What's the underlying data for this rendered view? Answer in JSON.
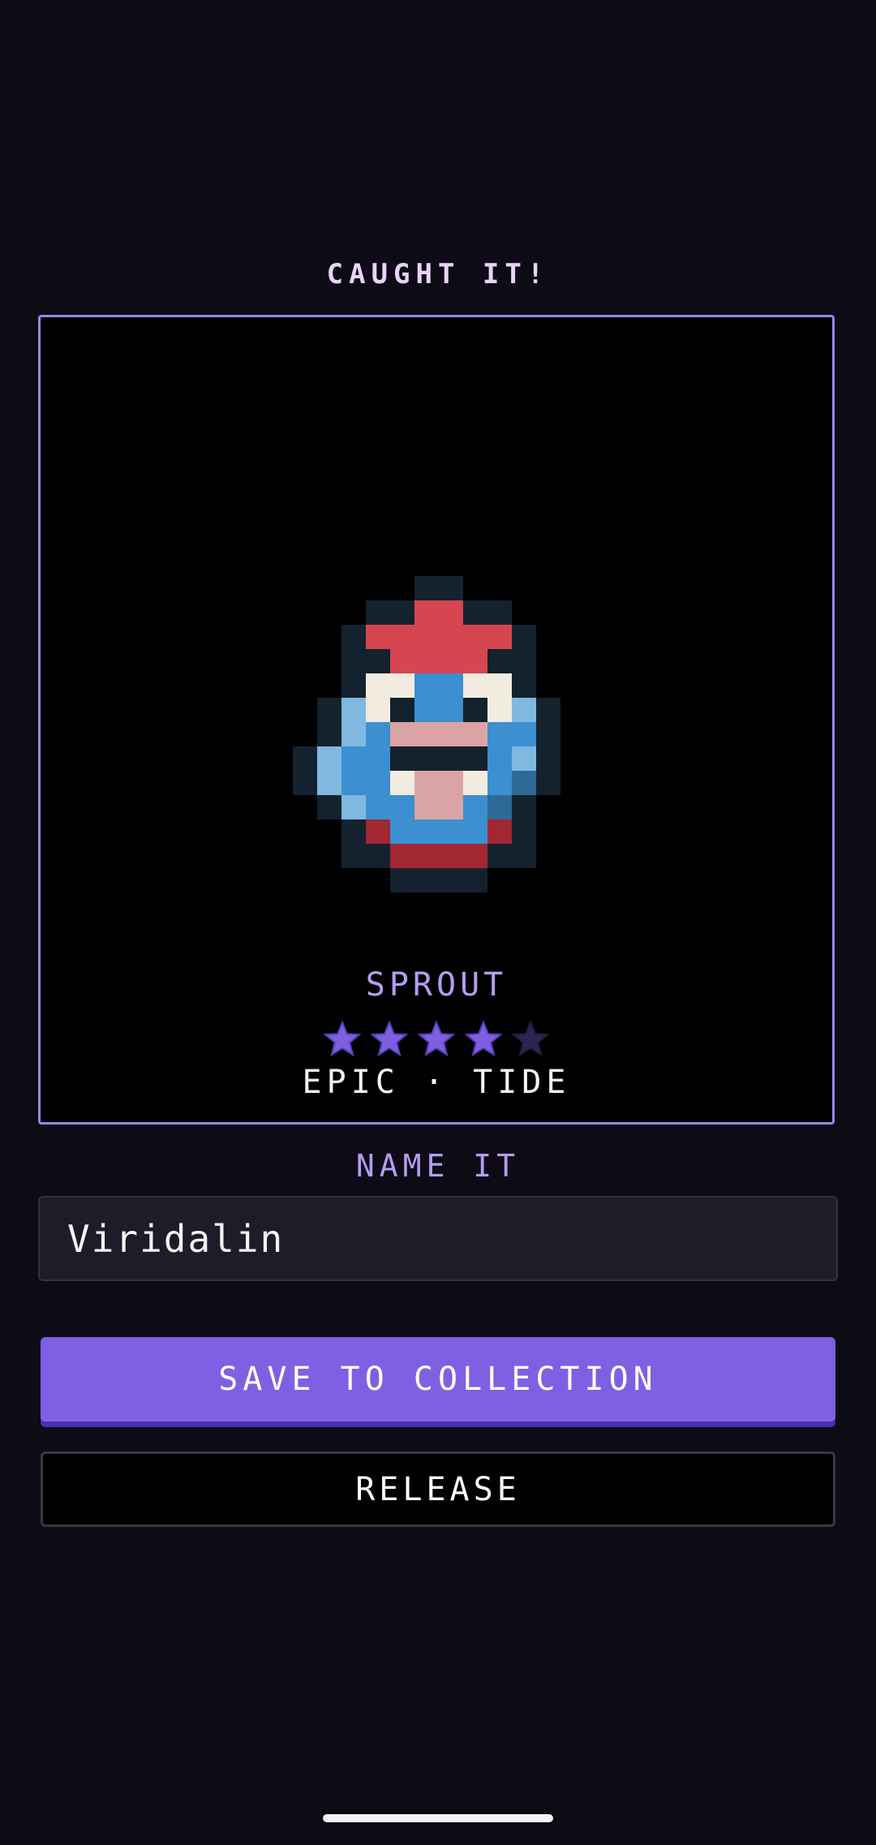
{
  "header": {
    "title": "CAUGHT IT!"
  },
  "creature": {
    "species": "SPROUT",
    "rating": 4,
    "max_rating": 5,
    "rarity_type": "EPIC · TIDE",
    "colors": {
      "outline": "#13222e",
      "crest": "#d64550",
      "body": "#3c8fd0",
      "highlight": "#80b8e0",
      "shade": "#2d6a96",
      "eye_white": "#f1ebe0",
      "mouth": "#dba4a4",
      "base": "#a32633"
    }
  },
  "rating_colors": {
    "filled": "#7f5ee0",
    "empty": "#2d2452"
  },
  "name_section": {
    "label": "NAME IT",
    "input_value": "Viridalin"
  },
  "actions": {
    "save_label": "SAVE TO COLLECTION",
    "release_label": "RELEASE"
  },
  "theme": {
    "background": "#0d0b16",
    "accent": "#7f60e2",
    "card_border": "#9b84e6"
  }
}
